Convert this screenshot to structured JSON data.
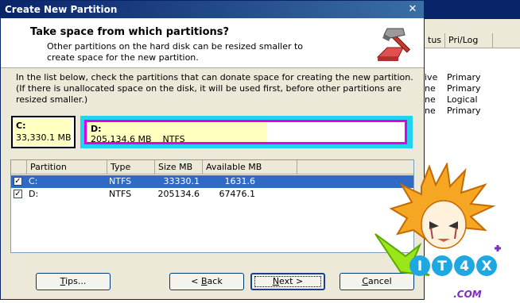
{
  "dialog": {
    "title": "Create New Partition",
    "header_title": "Take space from which partitions?",
    "header_subtitle": "Other partitions on the hard disk can be resized smaller to create space for the new partition.",
    "instructions": "In the list below, check the partitions that can donate space for creating the new partition. (If there is unallocated space on the disk, it will be used first, before other partitions are resized smaller.)"
  },
  "partition_map": {
    "c": {
      "letter": "C:",
      "info": "33,330.1 MB",
      "used_fraction": 0.95
    },
    "d": {
      "letter": "D:",
      "info": "205,134.6 MB    NTFS",
      "used_fraction": 0.56
    }
  },
  "list": {
    "columns": [
      "Partition",
      "Type",
      "Size MB",
      "Available MB"
    ],
    "rows": [
      {
        "checked": true,
        "partition": "C:",
        "type": "NTFS",
        "size": "33330.1",
        "available": "1631.6",
        "selected": true
      },
      {
        "checked": true,
        "partition": "D:",
        "type": "NTFS",
        "size": "205134.6",
        "available": "67476.1",
        "selected": false
      }
    ]
  },
  "buttons": {
    "tips_prefix": "",
    "tips_ul": "T",
    "tips_rest": "ips...",
    "back_prefix": "< ",
    "back_ul": "B",
    "back_rest": "ack",
    "next_ul": "N",
    "next_rest": "ext >",
    "cancel_prefix": "",
    "cancel_ul": "C",
    "cancel_rest": "ancel"
  },
  "background_app": {
    "columns": [
      "tus",
      "Pri/Log"
    ],
    "rows": [
      {
        "status": "ive",
        "prilog": "Primary"
      },
      {
        "status": "ne",
        "prilog": "Primary"
      },
      {
        "status": "ne",
        "prilog": "Logical"
      },
      {
        "status": "ne",
        "prilog": "Primary"
      }
    ]
  },
  "watermark": {
    "logo_text": "IT4X",
    "domain_text": ".COM"
  },
  "colors": {
    "title_bar": "#0a246a",
    "selection": "#316ac5",
    "partition_used": "#ffffc0",
    "partition_border_d": "#e000e0",
    "partition_border_extended": "#22d3f0"
  }
}
